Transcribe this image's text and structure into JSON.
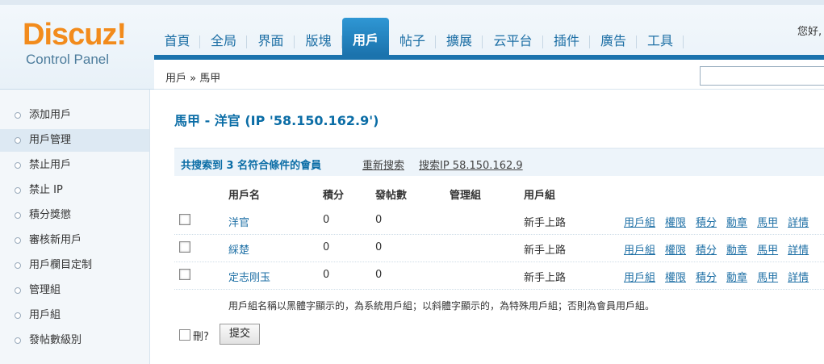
{
  "logo": {
    "brand": "Discuz!",
    "subtitle": "Control Panel"
  },
  "nav": {
    "tabs": [
      "首頁",
      "全局",
      "界面",
      "版塊",
      "用戶",
      "帖子",
      "擴展",
      "云平台",
      "插件",
      "廣告",
      "工具"
    ],
    "active": "用戶"
  },
  "greeting": "您好,",
  "breadcrumb": "用戶 » 馬甲",
  "sidebar": {
    "items": [
      "添加用戶",
      "用戶管理",
      "禁止用戶",
      "禁止 IP",
      "積分獎懲",
      "審核新用戶",
      "用戶欄目定制",
      "管理組",
      "用戶組",
      "發帖數級別"
    ],
    "active": "用戶管理"
  },
  "main": {
    "title": "馬甲 - 洋官 (IP '58.150.162.9')",
    "summary": "共搜索到 3 名符合條件的會員",
    "research_link": "重新搜索",
    "search_ip_link": "搜索IP 58.150.162.9",
    "columns": [
      "用戶名",
      "積分",
      "發帖數",
      "管理組",
      "用戶組"
    ],
    "rows": [
      {
        "name": "洋官",
        "credits": "0",
        "posts": "0",
        "admin_group": "",
        "user_group": "新手上路"
      },
      {
        "name": "綵楚",
        "credits": "0",
        "posts": "0",
        "admin_group": "",
        "user_group": "新手上路"
      },
      {
        "name": "定志刚玉",
        "credits": "0",
        "posts": "0",
        "admin_group": "",
        "user_group": "新手上路"
      }
    ],
    "row_actions": [
      "用戶組",
      "權限",
      "積分",
      "勳章",
      "馬甲",
      "詳情"
    ],
    "note": "用戶組名稱以黑體字顯示的，為系統用戶組；以斜體字顯示的，為特殊用戶組；否則為會員用戶組。",
    "delete_label": "刪?",
    "submit_label": "提交"
  }
}
